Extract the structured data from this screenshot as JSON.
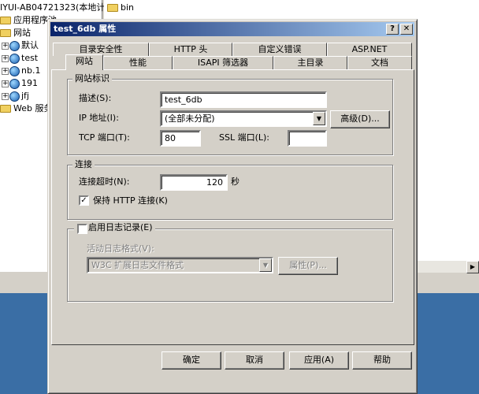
{
  "tree": {
    "header": "IYUI-AB04721323(本地计",
    "items": [
      {
        "label": "应用程序池",
        "kind": "folder"
      },
      {
        "label": "网站",
        "kind": "folder"
      },
      {
        "label": "默认",
        "kind": "site"
      },
      {
        "label": "test",
        "kind": "site"
      },
      {
        "label": "nb.1",
        "kind": "site"
      },
      {
        "label": "191",
        "kind": "site"
      },
      {
        "label": "jfj",
        "kind": "site"
      },
      {
        "label": "Web 服务",
        "kind": "folder"
      }
    ]
  },
  "list": {
    "items": [
      {
        "label": "bin"
      }
    ]
  },
  "dialog": {
    "title": "test_6db 属性",
    "help_btn": "?",
    "close_btn": "✕",
    "tabs_row1": [
      "目录安全性",
      "HTTP 头",
      "自定义错误",
      "ASP.NET"
    ],
    "tabs_row2": [
      "网站",
      "性能",
      "ISAPI 筛选器",
      "主目录",
      "文档"
    ],
    "active_tab": "网站"
  },
  "identity": {
    "group_title": "网站标识",
    "desc_label": "描述(S):",
    "desc_value": "test_6db",
    "ip_label": "IP 地址(I):",
    "ip_value": "(全部未分配)",
    "advanced_btn": "高级(D)...",
    "tcp_label": "TCP 端口(T):",
    "tcp_value": "80",
    "ssl_label": "SSL 端口(L):",
    "ssl_value": ""
  },
  "connection": {
    "group_title": "连接",
    "timeout_label": "连接超时(N):",
    "timeout_value": "120",
    "timeout_unit": "秒",
    "keepalive_label": "保持 HTTP 连接(K)",
    "keepalive_checked": true
  },
  "logging": {
    "enable_label": "启用日志记录(E)",
    "enable_checked": false,
    "format_label": "活动日志格式(V):",
    "format_value": "W3C 扩展日志文件格式",
    "properties_btn": "属性(P)..."
  },
  "buttons": {
    "ok": "确定",
    "cancel": "取消",
    "apply": "应用(A)",
    "help": "帮助"
  }
}
